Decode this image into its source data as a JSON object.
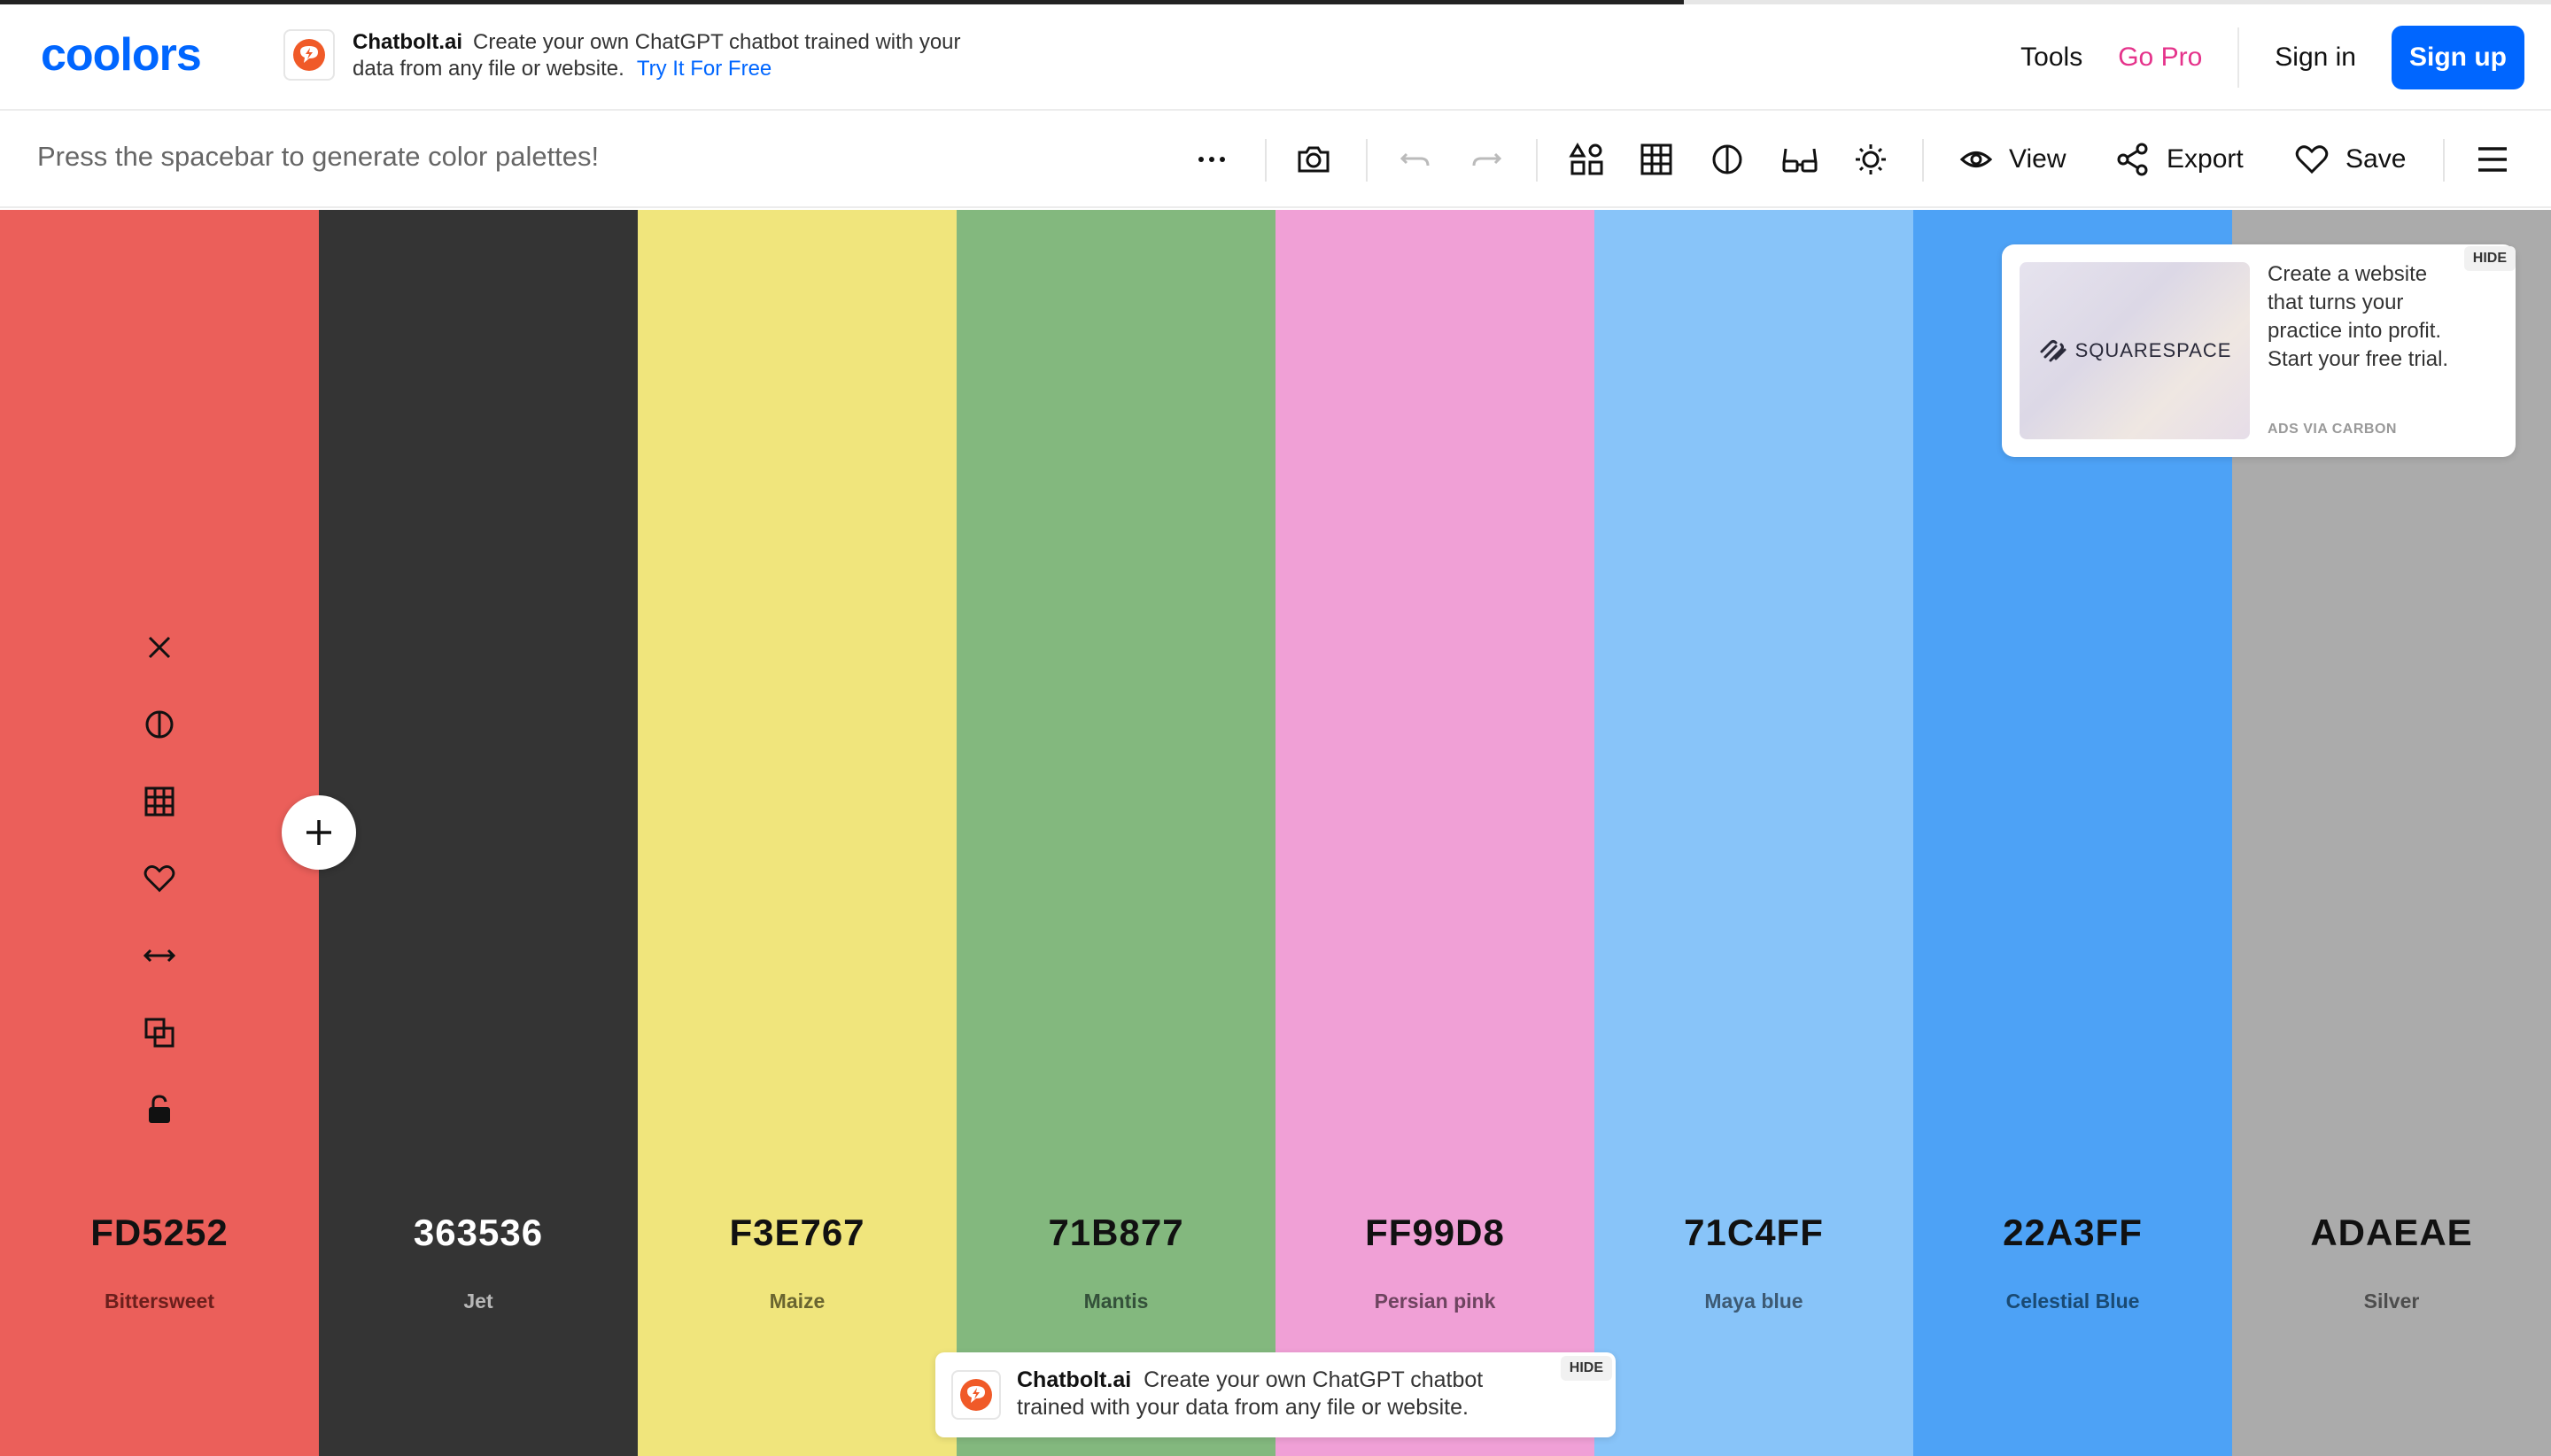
{
  "header": {
    "logo": "coolors",
    "ad": {
      "brand": "Chatbolt.ai",
      "text": "Create your own ChatGPT chatbot trained with your data from any file or website.",
      "cta": "Try It For Free"
    },
    "nav": {
      "tools": "Tools",
      "go_pro": "Go Pro",
      "sign_in": "Sign in",
      "sign_up": "Sign up"
    }
  },
  "toolbar": {
    "hint": "Press the spacebar to generate color palettes!",
    "view_label": "View",
    "export_label": "Export",
    "save_label": "Save"
  },
  "palette": {
    "colors": [
      {
        "hex": "FD5252",
        "name": "Bittersweet",
        "bg": "#EB5F5A",
        "text": "#111111",
        "sub": "#6b1f1c"
      },
      {
        "hex": "363536",
        "name": "Jet",
        "bg": "#343434",
        "text": "#ffffff",
        "sub": "#b8b8b8"
      },
      {
        "hex": "F3E767",
        "name": "Maize",
        "bg": "#F0E57C",
        "text": "#111111",
        "sub": "#6a6530"
      },
      {
        "hex": "71B877",
        "name": "Mantis",
        "bg": "#83B87E",
        "text": "#111111",
        "sub": "#34513a"
      },
      {
        "hex": "FF99D8",
        "name": "Persian pink",
        "bg": "#F0A0D6",
        "text": "#111111",
        "sub": "#6e4460"
      },
      {
        "hex": "71C4FF",
        "name": "Maya blue",
        "bg": "#88C4F9",
        "text": "#111111",
        "sub": "#3d5a74"
      },
      {
        "hex": "22A3FF",
        "name": "Celestial Blue",
        "bg": "#4DA2F6",
        "text": "#111111",
        "sub": "#1a4a73"
      },
      {
        "hex": "ADAEAE",
        "name": "Silver",
        "bg": "#ABABAB",
        "text": "#111111",
        "sub": "#4d4d4d"
      }
    ]
  },
  "carbon_ad": {
    "brand": "SQUARESPACE",
    "text": "Create a website that turns your practice into profit. Start your free trial.",
    "via": "ADS VIA CARBON",
    "hide": "HIDE"
  },
  "bottom_ad": {
    "brand": "Chatbolt.ai",
    "text": "Create your own ChatGPT chatbot trained with your data from any file or website.",
    "hide": "HIDE"
  },
  "icons": {
    "column_tools": [
      "close-icon",
      "contrast-icon",
      "grid-icon",
      "heart-icon",
      "drag-arrows-icon",
      "copy-icon",
      "unlock-icon"
    ],
    "add": "plus-icon"
  }
}
